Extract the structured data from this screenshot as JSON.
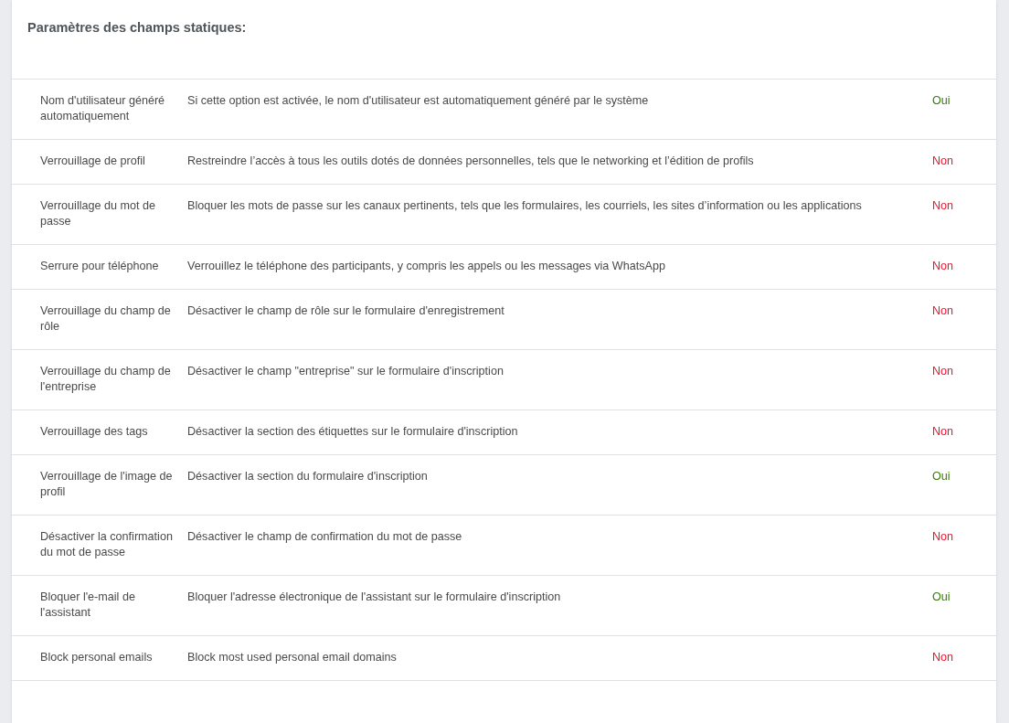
{
  "section": {
    "title": "Paramètres des champs statiques:"
  },
  "rows": [
    {
      "label": "Nom d'utilisateur généré automatiquement",
      "description": "Si cette option est activée, le nom d'utilisateur est automatiquement généré par le système",
      "value": "Oui",
      "enabled": true
    },
    {
      "label": "Verrouillage de profil",
      "description": "Restreindre l’accès à tous les outils dotés de données personnelles, tels que le networking et l’édition de profils",
      "value": "Non",
      "enabled": false
    },
    {
      "label": "Verrouillage du mot de passe",
      "description": "Bloquer les mots de passe sur les canaux pertinents, tels que les formulaires, les courriels, les sites d’information ou les applications",
      "value": "Non",
      "enabled": false
    },
    {
      "label": "Serrure pour téléphone",
      "description": "Verrouillez le téléphone des participants, y compris les appels ou les messages via WhatsApp",
      "value": "Non",
      "enabled": false
    },
    {
      "label": "Verrouillage du champ de rôle",
      "description": "Désactiver le champ de rôle sur le formulaire d'enregistrement",
      "value": "Non",
      "enabled": false
    },
    {
      "label": "Verrouillage du champ de l'entreprise",
      "description": "Désactiver le champ \"entreprise\" sur le formulaire d'inscription",
      "value": "Non",
      "enabled": false
    },
    {
      "label": "Verrouillage des tags",
      "description": "Désactiver la section des étiquettes sur le formulaire d'inscription",
      "value": "Non",
      "enabled": false
    },
    {
      "label": "Verrouillage de l'image de profil",
      "description": "Désactiver la section du formulaire d'inscription",
      "value": "Oui",
      "enabled": true
    },
    {
      "label": "Désactiver la confirmation du mot de passe",
      "description": "Désactiver le champ de confirmation du mot de passe",
      "value": "Non",
      "enabled": false
    },
    {
      "label": "Bloquer l'e-mail de l'assistant",
      "description": "Bloquer l'adresse électronique de l'assistant sur le formulaire d'inscription",
      "value": "Oui",
      "enabled": true
    },
    {
      "label": "Block personal emails",
      "description": "Block most used personal email domains",
      "value": "Non",
      "enabled": false
    }
  ]
}
